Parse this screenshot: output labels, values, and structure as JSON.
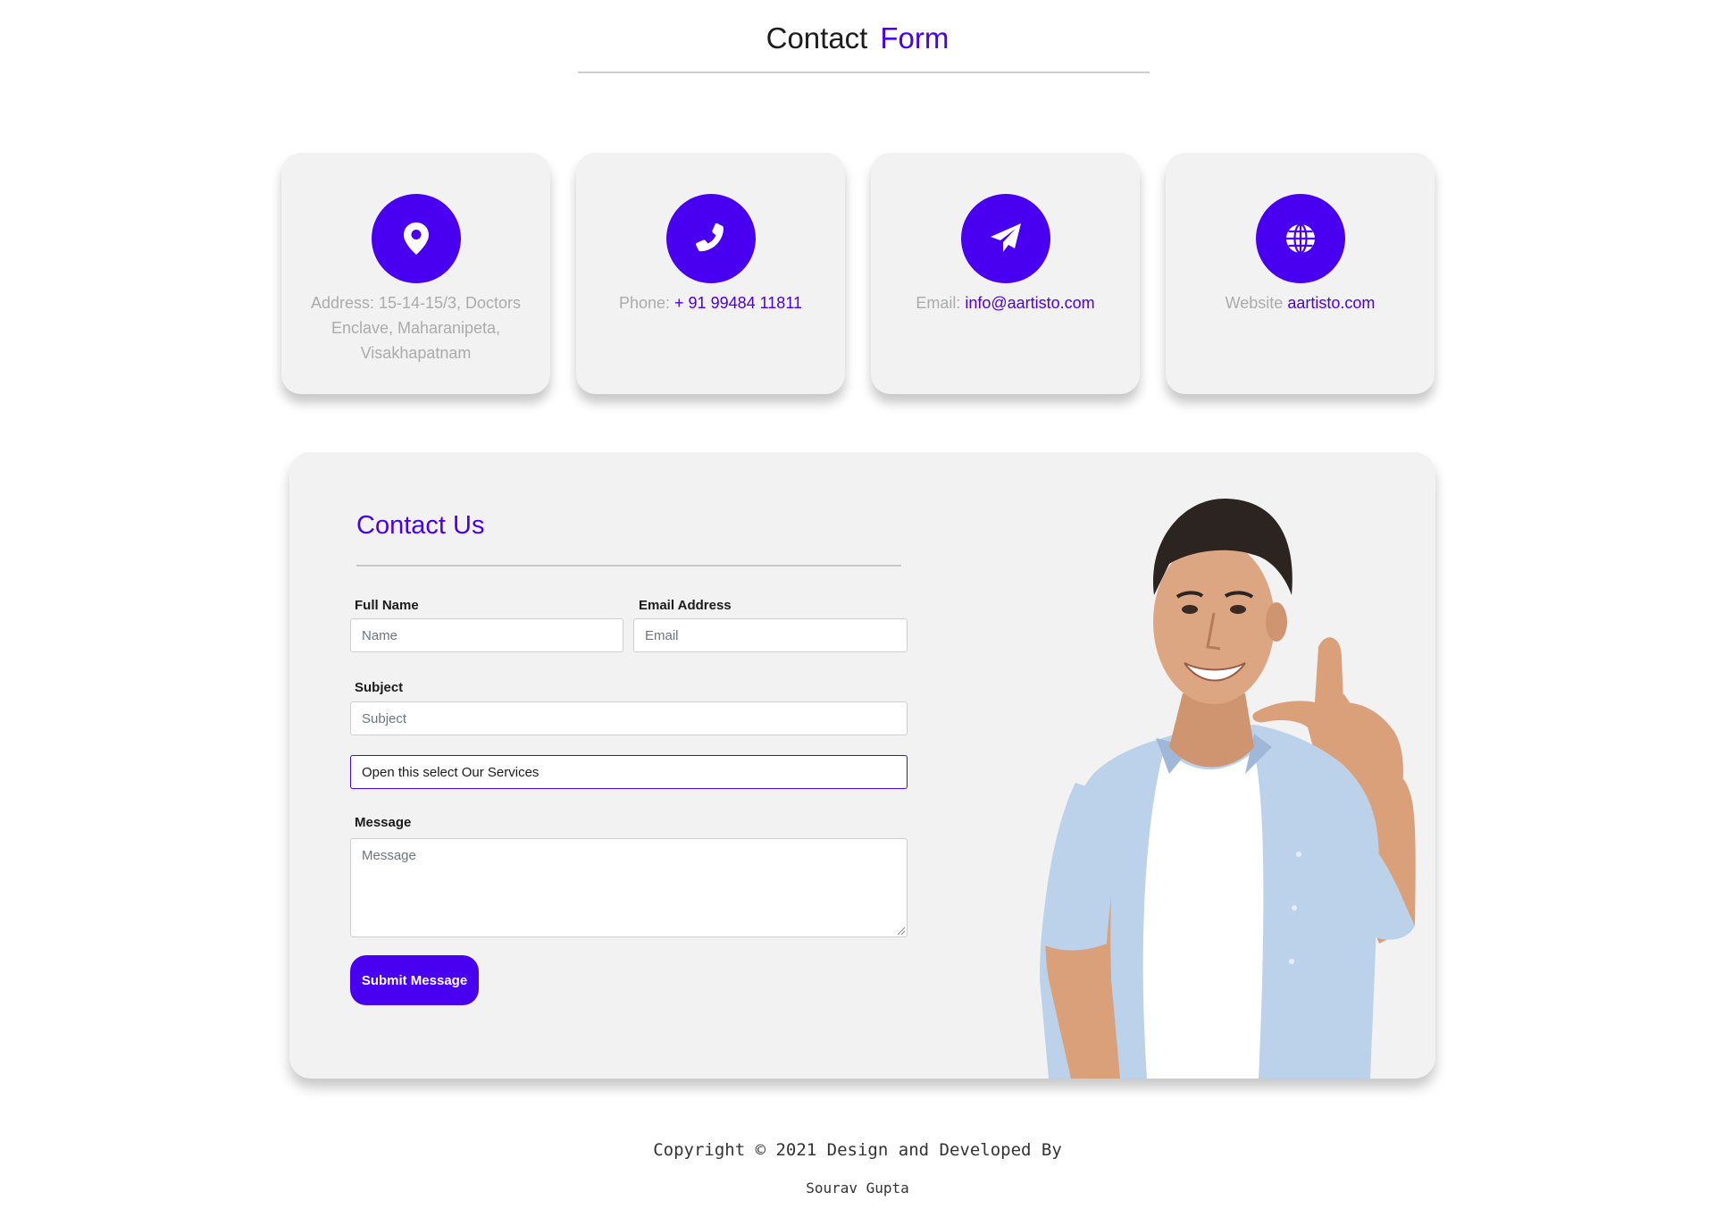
{
  "header": {
    "title_main": "Contact",
    "title_accent": "Form"
  },
  "info_cards": [
    {
      "icon": "location-pin-icon",
      "label": "Address: 15-14-15/3, Doctors Enclave, Maharanipeta, Visakhapatnam",
      "link": ""
    },
    {
      "icon": "phone-icon",
      "label": "Phone: ",
      "link": "+ 91 99484 11811"
    },
    {
      "icon": "paper-plane-icon",
      "label": "Email: ",
      "link": "info@aartisto.com"
    },
    {
      "icon": "globe-icon",
      "label": "Website ",
      "link": "aartisto.com"
    }
  ],
  "form": {
    "heading": "Contact Us",
    "full_name_label": "Full Name",
    "full_name_placeholder": "Name",
    "email_label": "Email Address",
    "email_placeholder": "Email",
    "subject_label": "Subject",
    "subject_placeholder": "Subject",
    "services_select_value": "Open this select Our Services",
    "message_label": "Message",
    "message_placeholder": "Message",
    "submit_label": "Submit Message"
  },
  "footer": {
    "copyright": "Copyright © 2021 Design and Developed By",
    "author": "Sourav Gupta"
  },
  "colors": {
    "accent": "#4a00f0",
    "card_bg": "#f2f2f2"
  }
}
